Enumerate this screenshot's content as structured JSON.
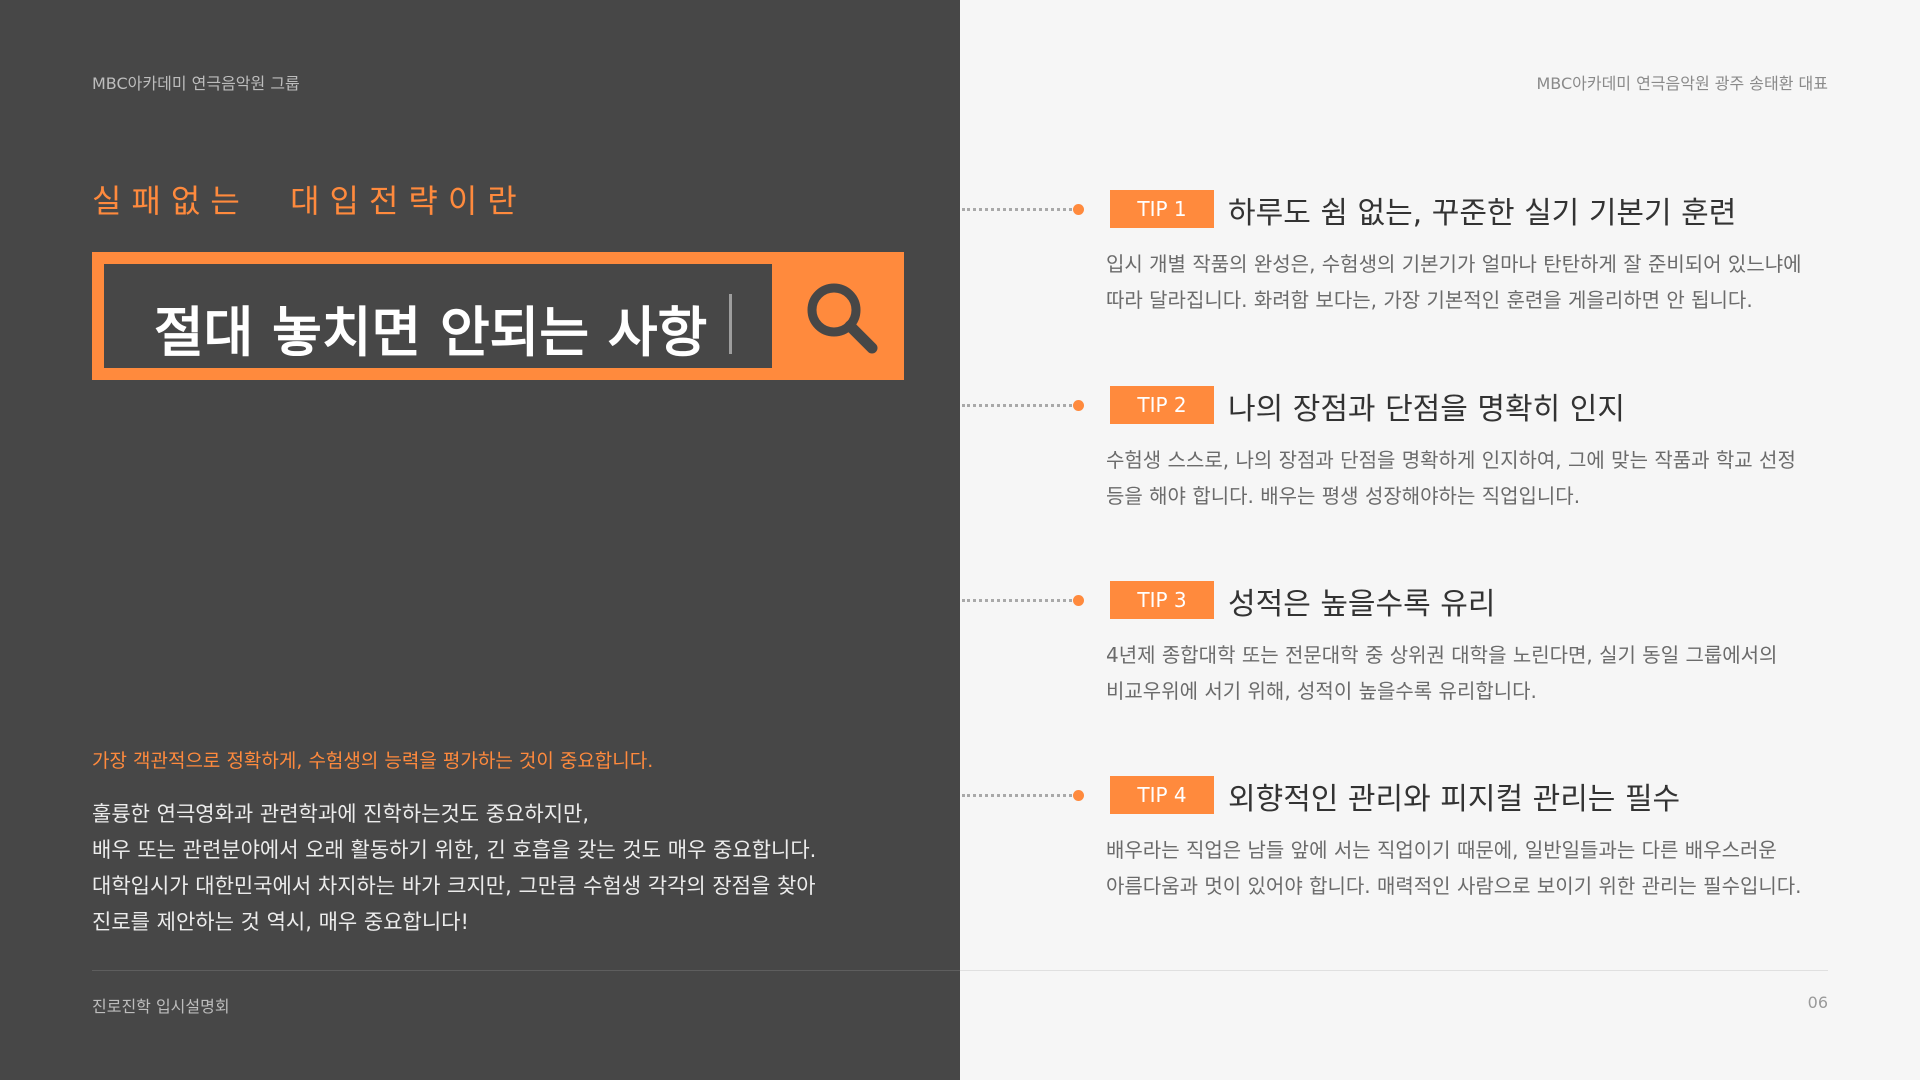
{
  "header": {
    "left": "MBC아카데미 연극음악원 그룹",
    "right": "MBC아카데미 연극음악원 광주 송태환 대표"
  },
  "left_panel": {
    "eyebrow": "실패없는  대입전략이란",
    "search_text": "절대 놓치면 안되는 사항",
    "search_icon": "search-icon",
    "highlight": "가장 객관적으로 정확하게, 수험생의 능력을 평가하는 것이 중요합니다.",
    "body_lines": [
      "훌륭한 연극영화과 관련학과에 진학하는것도 중요하지만,",
      "배우 또는 관련분야에서 오래 활동하기 위한, 긴 호흡을 갖는 것도 매우 중요합니다.",
      "대학입시가 대한민국에서 차지하는 바가 크지만, 그만큼 수험생 각각의 장점을 찾아",
      "진로를 제안하는 것 역시, 매우 중요합니다!"
    ]
  },
  "tips": [
    {
      "badge": "TIP 1",
      "title": "하루도 쉼 없는, 꾸준한 실기 기본기 훈련",
      "desc": [
        "입시 개별 작품의 완성은, 수험생의 기본기가 얼마나 탄탄하게 잘 준비되어 있느냐에",
        "따라 달라집니다. 화려함 보다는, 가장 기본적인 훈련을 게을리하면 안 됩니다."
      ]
    },
    {
      "badge": "TIP 2",
      "title": "나의 장점과 단점을 명확히 인지",
      "desc": [
        "수험생 스스로, 나의 장점과 단점을 명확하게 인지하여, 그에 맞는 작품과 학교 선정",
        "등을 해야 합니다. 배우는 평생 성장해야하는 직업입니다."
      ]
    },
    {
      "badge": "TIP 3",
      "title": "성적은 높을수록 유리",
      "desc": [
        "4년제 종합대학 또는 전문대학 중 상위권 대학을 노린다면, 실기 동일 그룹에서의",
        "비교우위에 서기 위해, 성적이 높을수록 유리합니다."
      ]
    },
    {
      "badge": "TIP 4",
      "title": "외향적인 관리와 피지컬 관리는 필수",
      "desc": [
        "배우라는 직업은 남들 앞에 서는 직업이기 때문에, 일반일들과는 다른 배우스러운",
        "아름다움과 멋이 있어야 합니다. 매력적인 사람으로 보이기 위한 관리는 필수입니다."
      ]
    }
  ],
  "footer": {
    "left": "진로진학 입시설명회",
    "page": "06"
  },
  "colors": {
    "accent": "#ff8a3d",
    "dark_panel": "#474747",
    "light_panel": "#f6f6f6"
  }
}
